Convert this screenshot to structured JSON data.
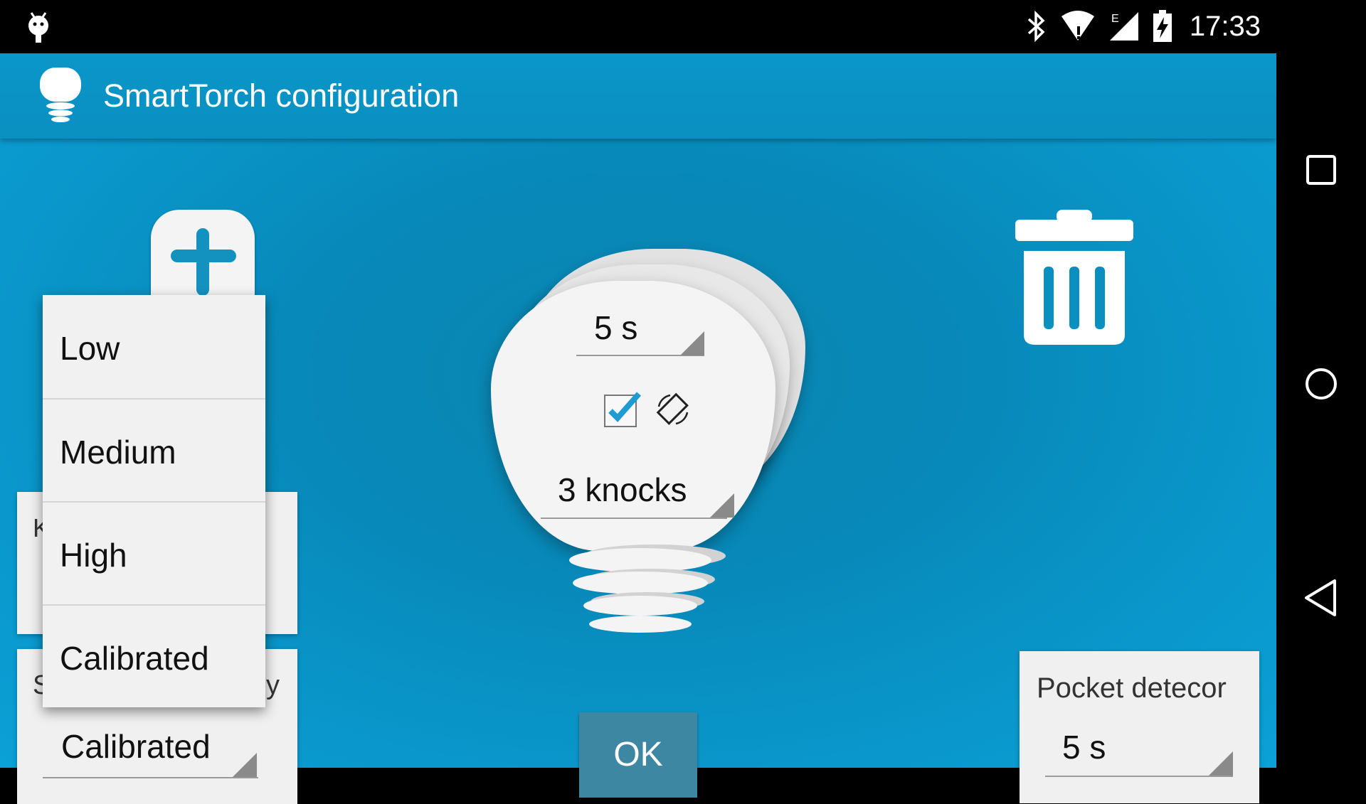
{
  "status_bar": {
    "time": "17:33"
  },
  "app": {
    "title": "SmartTorch configuration"
  },
  "bulb": {
    "duration": "5 s",
    "knocks": "3 knocks",
    "checkbox_checked": true
  },
  "dropdown": {
    "items": [
      "Low",
      "Medium",
      "High",
      "Calibrated"
    ]
  },
  "sensitivity": {
    "label_partial_left": "S",
    "label_partial_right": "y",
    "value": "Calibrated"
  },
  "knock_card": {
    "label_partial": "K"
  },
  "pocket": {
    "label": "Pocket detecor",
    "value": "5 s"
  },
  "ok_button": {
    "label": "OK"
  },
  "colors": {
    "accent": "#0a98cc",
    "ok": "#3e87a3"
  }
}
